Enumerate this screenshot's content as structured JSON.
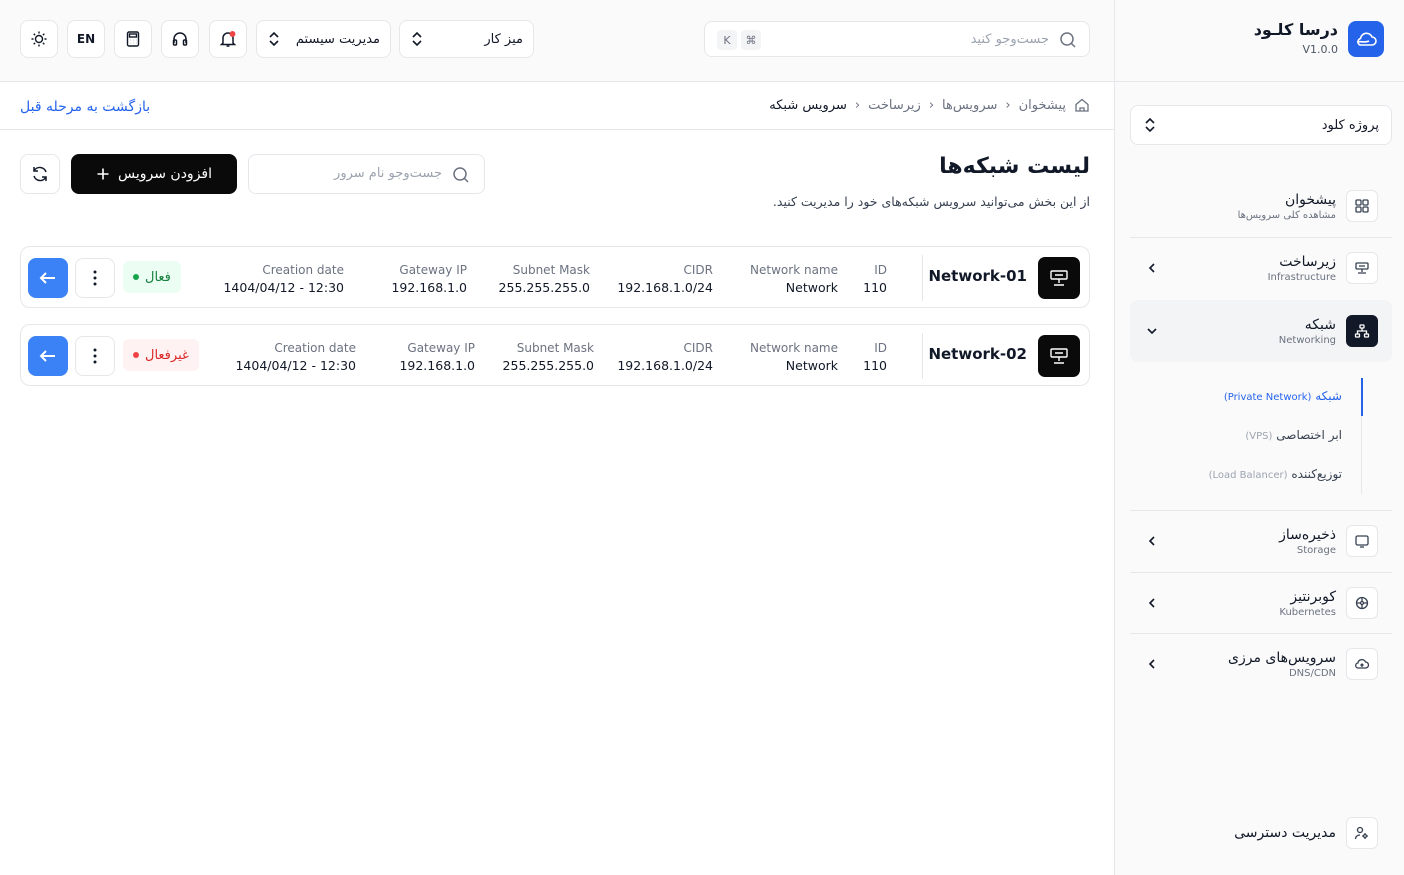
{
  "app": {
    "name": "درسا کلـود",
    "version": "V1.0.0"
  },
  "sidebar": {
    "project": "پروژه کلود",
    "items": [
      {
        "title": "پیشخوان",
        "subtitle": "مشاهده کلی سرویس‌ها",
        "icon": "grid-icon"
      },
      {
        "title": "زیرساخت",
        "subtitle": "Infrastructure",
        "icon": "server-icon"
      },
      {
        "title": "شبکه",
        "subtitle": "Networking",
        "icon": "network-icon"
      },
      {
        "title": "ذخیره‌ساز",
        "subtitle": "Storage",
        "icon": "storage-icon"
      },
      {
        "title": "کوبرنتیز",
        "subtitle": "Kubernetes",
        "icon": "kubernetes-icon"
      },
      {
        "title": "سرویس‌های مرزی",
        "subtitle": "DNS/CDN",
        "icon": "cloud-icon"
      }
    ],
    "subitems": [
      {
        "label": "شبکه",
        "en": "(Private Network)"
      },
      {
        "label": "ابر اختصاصی",
        "en": "(VPS)"
      },
      {
        "label": "توزیع‌کننده",
        "en": "(Load Balancer)"
      }
    ],
    "access": "مدیریت دسترسی"
  },
  "topbar": {
    "search_placeholder": "جست‌وجو کنید",
    "kbd_cmd": "⌘",
    "kbd_k": "K",
    "workspace": "میز کار",
    "system": "مدیریت سیستم",
    "lang": "EN"
  },
  "breadcrumb": [
    "پیشخوان",
    "سرویس‌ها",
    "زیرساخت",
    "سرویس شبکه"
  ],
  "back_label": "بازگشت به مرحله قبل",
  "page": {
    "title": "لیست شبکه‌ها",
    "subtitle": "از این بخش می‌توانید سرویس شبکه‌های خود را مدیریت کنید.",
    "search_placeholder": "جست‌وجو نام سرور",
    "add_label": "افزودن سرویس"
  },
  "labels": {
    "id": "ID",
    "network_name": "Network name",
    "cidr": "CIDR",
    "subnet": "Subnet Mask",
    "gateway": "Gateway IP",
    "created": "Creation date"
  },
  "networks": [
    {
      "name": "Network-01",
      "id": "110",
      "network_name": "Network",
      "cidr": "192.168.1.0/24",
      "subnet": "255.255.255.0",
      "gateway": "192.168.1.0",
      "created": "1404/04/12 - 12:30",
      "status": "فعال"
    },
    {
      "name": "Network-02",
      "id": "110",
      "network_name": "Network",
      "cidr": "192.168.1.0/24",
      "subnet": "255.255.255.0",
      "gateway": "192.168.1.0",
      "created": "1404/04/12 - 12:30",
      "status": "غیرفعال"
    }
  ],
  "colors": {
    "accent": "#2563eb",
    "button_dark": "#0a0a0a",
    "active": "#16a34a",
    "inactive": "#ef4444"
  }
}
